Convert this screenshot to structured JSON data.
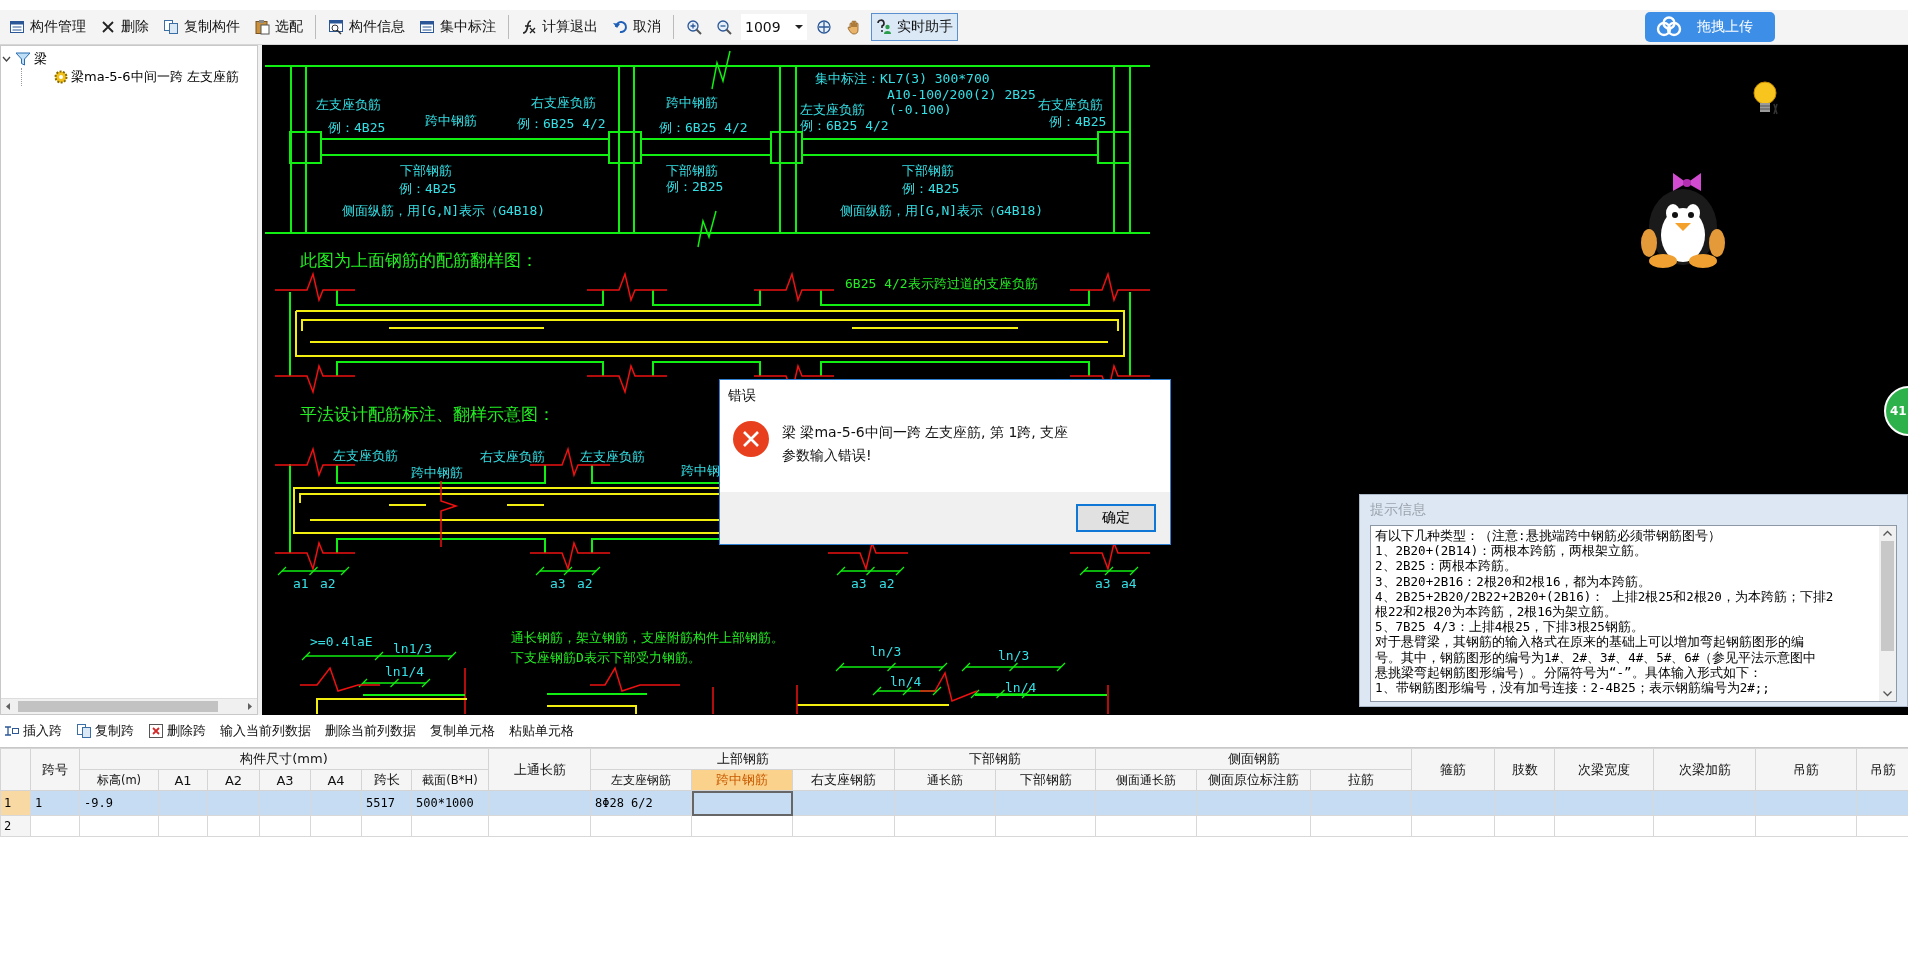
{
  "toolbar": {
    "items": [
      {
        "kind": "list",
        "label": "构件管理"
      },
      {
        "kind": "delete",
        "label": "删除"
      },
      {
        "kind": "copy",
        "label": "复制构件"
      },
      {
        "kind": "paste",
        "label": "选配"
      },
      {
        "kind": "separator"
      },
      {
        "kind": "info",
        "label": "构件信息"
      },
      {
        "kind": "list",
        "label": "集中标注"
      },
      {
        "kind": "separator"
      },
      {
        "kind": "fx",
        "label": "计算退出"
      },
      {
        "kind": "undo",
        "label": "取消"
      },
      {
        "kind": "separator"
      },
      {
        "kind": "zoom-in"
      },
      {
        "kind": "zoom-out"
      },
      {
        "kind": "combo",
        "value": "1009"
      },
      {
        "kind": "zoom-fit"
      },
      {
        "kind": "hand"
      }
    ],
    "assistant_toggle": {
      "label": "实时助手",
      "on": true
    },
    "upload_button": "拖拽上传"
  },
  "tree": [
    {
      "label": "梁",
      "expanded": true,
      "children": [
        {
          "label": "梁ma-5-6中间一跨 左支座筋"
        }
      ]
    }
  ],
  "drawing": {
    "labels": [
      {
        "text": "左支座负筋",
        "kind": "note"
      },
      {
        "text": "例：4B25",
        "kind": "note"
      },
      {
        "text": "跨中钢筋",
        "kind": "note"
      },
      {
        "text": "右支座负筋",
        "kind": "note"
      },
      {
        "text": "例：6B25 4/2",
        "kind": "note"
      },
      {
        "text": "跨中钢筋",
        "kind": "note"
      },
      {
        "text": "例：6B25 4/2",
        "kind": "note"
      },
      {
        "text": "集中标注：KL7(3) 300*700",
        "kind": "note"
      },
      {
        "text": "A10-100/200(2) 2B25",
        "kind": "note"
      },
      {
        "text": "左支座负筋",
        "kind": "note"
      },
      {
        "text": "(-0.100)",
        "kind": "note"
      },
      {
        "text": "例：6B25 4/2",
        "kind": "note"
      },
      {
        "text": "右支座负筋",
        "kind": "note"
      },
      {
        "text": "例：4B25",
        "kind": "note"
      },
      {
        "text": "下部钢筋",
        "kind": "note"
      },
      {
        "text": "例：4B25",
        "kind": "note"
      },
      {
        "text": "侧面纵筋，用[G,N]表示（G4B18)",
        "kind": "note"
      },
      {
        "text": "下部钢筋",
        "kind": "note"
      },
      {
        "text": "例：2B25",
        "kind": "note"
      },
      {
        "text": "下部钢筋",
        "kind": "note"
      },
      {
        "text": "例：4B25",
        "kind": "note"
      },
      {
        "text": "侧面纵筋，用[G,N]表示（G4B18)",
        "kind": "note"
      },
      {
        "text": "此图为上面钢筋的配筋翻样图：",
        "kind": "heading"
      },
      {
        "text": "6B25 4/2表示跨过道的支座负筋",
        "kind": "caption"
      },
      {
        "text": "平法设计配筋标注、翻样示意图：",
        "kind": "heading"
      },
      {
        "text": "左支座负筋",
        "kind": "note"
      },
      {
        "text": "跨中钢筋",
        "kind": "note"
      },
      {
        "text": "右支座负筋",
        "kind": "note"
      },
      {
        "text": "左支座负筋",
        "kind": "note"
      },
      {
        "text": "跨中钢",
        "kind": "note"
      },
      {
        "text": "a1",
        "kind": "note"
      },
      {
        "text": "a2",
        "kind": "note"
      },
      {
        "text": "a3",
        "kind": "note"
      },
      {
        "text": "a2",
        "kind": "note"
      },
      {
        "text": "a3",
        "kind": "note"
      },
      {
        "text": "a2",
        "kind": "note"
      },
      {
        "text": "a3",
        "kind": "note"
      },
      {
        "text": "a4",
        "kind": "note"
      },
      {
        "text": ">=0.4laE",
        "kind": "note"
      },
      {
        "text": "ln1/3",
        "kind": "note"
      },
      {
        "text": "ln1/4",
        "kind": "note"
      },
      {
        "text": "通长钢筋，架立钢筋，支座附筋构件上部钢筋。",
        "kind": "caption"
      },
      {
        "text": "下支座钢筋D表示下部受力钢筋。",
        "kind": "caption"
      },
      {
        "text": "ln/3",
        "kind": "note"
      },
      {
        "text": "ln/4",
        "kind": "note"
      },
      {
        "text": "ln/3",
        "kind": "note"
      },
      {
        "text": "ln/4",
        "kind": "note"
      }
    ]
  },
  "side_badge": "41",
  "tip_panel": {
    "title": "提示信息",
    "lines": [
      "有以下几种类型：（注意:悬挑端跨中钢筋必须带钢筋图号）",
      "1、2B20+(2B14)：两根本跨筋，两根架立筋。",
      "2、2B25：两根本跨筋。",
      "3、2B20+2B16：2根20和2根16，都为本跨筋。",
      "4、2B25+2B20/2B22+2B20+(2B16)：  上排2根25和2根20，为本跨筋；下排2",
      "根22和2根20为本跨筋，2根16为架立筋。",
      "5、7B25 4/3：上排4根25，下排3根25钢筋。",
      "对于悬臂梁，其钢筋的输入格式在原来的基础上可以增加弯起钢筋图形的编",
      "号。其中，钢筋图形的编号为1#、2#、3#、4#、5#、6#（参见平法示意图中",
      "悬挑梁弯起钢筋图形编号）。分隔符号为“-”。具体输入形式如下：",
      "1、带钢筋图形编号，没有加号连接：2-4B25；表示钢筋编号为2#;;"
    ]
  },
  "dialog": {
    "title": "错误",
    "message": "梁 梁ma-5-6中间一跨 左支座筋, 第 1跨, 支座参数输入错误!",
    "button": "确定"
  },
  "grid_toolbar": [
    {
      "kind": "insert",
      "label": "插入跨"
    },
    {
      "kind": "copy",
      "label": "复制跨"
    },
    {
      "kind": "delete-row",
      "label": "删除跨"
    },
    {
      "kind": "text",
      "label": "输入当前列数据"
    },
    {
      "kind": "text",
      "label": "删除当前列数据"
    },
    {
      "kind": "text",
      "label": "复制单元格"
    },
    {
      "kind": "text",
      "label": "粘贴单元格"
    }
  ],
  "table": {
    "columns": [
      {
        "label": "跨号",
        "selected": false
      },
      {
        "label": "构件尺寸(mm)",
        "children": [
          {
            "label": "标高(m)",
            "selected": false
          },
          {
            "label": "A1",
            "selected": false
          },
          {
            "label": "A2",
            "selected": false
          },
          {
            "label": "A3",
            "selected": false
          },
          {
            "label": "A4",
            "selected": false
          },
          {
            "label": "跨长",
            "selected": false
          },
          {
            "label": "截面(B*H)",
            "selected": false
          }
        ]
      },
      {
        "label": "上通长筋",
        "selected": false
      },
      {
        "label": "上部钢筋",
        "children": [
          {
            "label": "左支座钢筋",
            "selected": false
          },
          {
            "label": "跨中钢筋",
            "selected": true
          },
          {
            "label": "右支座钢筋",
            "selected": false
          }
        ]
      },
      {
        "label": "下部钢筋",
        "children": [
          {
            "label": "通长筋",
            "selected": false
          },
          {
            "label": "下部钢筋",
            "selected": false
          }
        ]
      },
      {
        "label": "侧面钢筋",
        "children": [
          {
            "label": "侧面通长筋",
            "selected": false
          },
          {
            "label": "侧面原位标注筋",
            "selected": false
          },
          {
            "label": "拉筋",
            "selected": false
          }
        ]
      },
      {
        "label": "箍筋",
        "selected": false
      },
      {
        "label": "肢数",
        "selected": false
      },
      {
        "label": "次梁宽度",
        "selected": false
      },
      {
        "label": "次梁加筋",
        "selected": false
      },
      {
        "label": "吊筋",
        "selected": false
      },
      {
        "label": "吊筋",
        "selected": false
      }
    ],
    "rows": [
      {
        "number": "1",
        "selected": true,
        "cells": [
          "1",
          "-9.9",
          null,
          null,
          null,
          null,
          "5517",
          "500*1000",
          null,
          "8Φ28 6/2"
        ]
      },
      {
        "number": "2",
        "selected": false
      }
    ]
  }
}
